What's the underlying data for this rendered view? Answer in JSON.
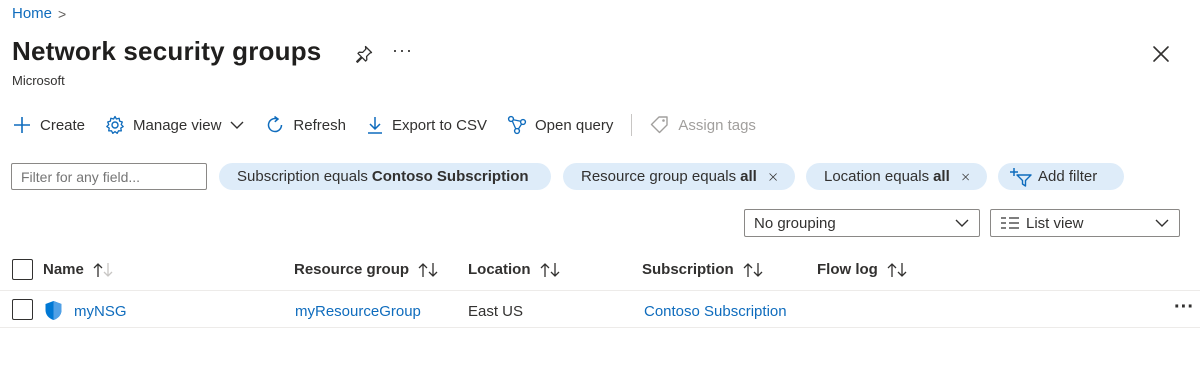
{
  "breadcrumb": {
    "home": "Home",
    "separator": ">"
  },
  "header": {
    "title": "Network security groups",
    "subtitle": "Microsoft",
    "more": "···"
  },
  "toolbar": {
    "create": "Create",
    "manage_view": "Manage view",
    "refresh": "Refresh",
    "export_csv": "Export to CSV",
    "open_query": "Open query",
    "assign_tags": "Assign tags"
  },
  "filters": {
    "search_placeholder": "Filter for any field...",
    "subscription": {
      "prefix": "Subscription equals",
      "value": "Contoso Subscription"
    },
    "resource_group": {
      "prefix": "Resource group equals",
      "value": "all"
    },
    "location": {
      "prefix": "Location equals",
      "value": "all"
    },
    "add_filter": "Add filter"
  },
  "view_controls": {
    "grouping": "No grouping",
    "view": "List view"
  },
  "table": {
    "columns": [
      "Name",
      "Resource group",
      "Location",
      "Subscription",
      "Flow log"
    ],
    "rows": [
      {
        "name": "myNSG",
        "resource_group": "myResourceGroup",
        "location": "East US",
        "subscription": "Contoso Subscription",
        "flow_log": ""
      }
    ],
    "row_menu": "···"
  },
  "colors": {
    "accent": "#0f6cbd",
    "pill_bg": "#deecf9",
    "text": "#323130"
  }
}
